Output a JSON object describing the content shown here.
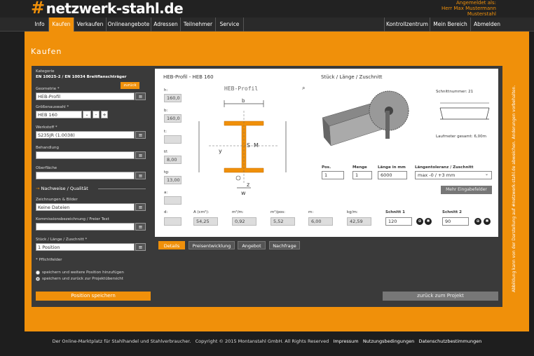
{
  "brand": {
    "logo_symbol": "#",
    "logo_text": "netzwerk-stahl.de",
    "accent": "#f0900a"
  },
  "user": {
    "line1": "Angemeldet als:",
    "line2": "Herr Max Mustermann",
    "line3": "Musterstahl"
  },
  "nav": {
    "left": [
      "Info",
      "Kaufen",
      "Verkaufen",
      "Onlineangebote",
      "Adressen",
      "Teilnehmer",
      "Service"
    ],
    "right": [
      "Kontrollzentrum",
      "Mein Bereich",
      "Abmelden"
    ],
    "active": "Kaufen"
  },
  "page": {
    "title": "Kaufen"
  },
  "form": {
    "category_label": "Kategorie",
    "category_value": "EN 10025-2 / EN 10034 Breitflanschträger",
    "back_button": "zurück",
    "geometry_label": "Geometrie *",
    "geometry_value": "HEB-Profil",
    "size_label": "Größenauswahl *",
    "size_value": "HEB 160",
    "material_label": "Werkstoff *",
    "material_value": "S235JR (1.0038)",
    "treatment_label": "Behandlung",
    "treatment_value": "",
    "surface_label": "Oberfläche",
    "surface_value": "",
    "section_heading": "Nachweise / Qualität",
    "drawings_label": "Zeichnungen & Bilder",
    "drawings_value": "Keine Dateien",
    "commission_label": "Kommissionsbezeichnung / Freier Text",
    "commission_value": "",
    "pieces_label": "Stück / Länge / Zuschnitt *",
    "pieces_value": "1 Position",
    "required_note": "* Pflichtfelder",
    "radio1": "speichern und weitere Position hinzufügen",
    "radio2": "speichern und zurück zur Projektübersicht",
    "save_button": "Position speichern"
  },
  "profile": {
    "title": "HEB-Profil - HEB 160",
    "diagram_caption": "HEB-Profil",
    "h_label": "h:",
    "h_value": "160,0",
    "b_label": "b:",
    "b_value": "160,0",
    "t1_label": "t:",
    "t1_value": "",
    "tf_label": "tf:",
    "tf_value": "8,00",
    "tg_label": "tg:",
    "tg_value": "13,00",
    "a_label": "a:",
    "a_value": "",
    "dim_b": "b",
    "dim_s": "S",
    "dim_m": "M",
    "dim_y": "y",
    "dim_z": "z",
    "dim_w": "w",
    "props": [
      {
        "label": "d:",
        "value": ""
      },
      {
        "label": "A (cm²):",
        "value": "54,25"
      },
      {
        "label": "m²/m:",
        "value": "0,92"
      },
      {
        "label": "m²/pos:",
        "value": "5,52"
      },
      {
        "label": "m:",
        "value": "6,00"
      },
      {
        "label": "kg/m:",
        "value": "42,59"
      }
    ]
  },
  "cutting": {
    "title": "Stück / Länge / Zuschnitt",
    "cut_number_label": "Schnittnummer: 21",
    "total_length": "Laufmeter gesamt: 6,00m",
    "pos_label": "Pos.",
    "pos_value": "1",
    "qty_label": "Menge",
    "qty_value": "1",
    "length_label": "Länge in mm",
    "length_value": "6000",
    "tolerance_label": "Längentoleranz / Zuschnitt",
    "tolerance_value": "max -0 / +3 mm",
    "more_button": "Mehr Eingabefelder",
    "cut1_label": "Schnitt 1",
    "cut1_value": "120",
    "cut2_label": "Schnitt 2",
    "cut2_value": "90"
  },
  "tabs": [
    "Details",
    "Preisentwicklung",
    "Angebot",
    "Nachfrage"
  ],
  "back_project_button": "zurück zum Projekt",
  "side_note": "Abbildung kann von der Darstellung auf #netzwerk-stahl.de abweichen. Änderungen vorbehalten.",
  "footer": {
    "text": "Der Online-Marktplatz für Stahlhandel und Stahlverbraucher.",
    "copyright": "Copyright © 2015 Montanstahl GmbH. All Rights Reserved",
    "links": [
      "Impressum",
      "Nutzungsbedingungen",
      "Datenschutzbestimmungen"
    ]
  }
}
